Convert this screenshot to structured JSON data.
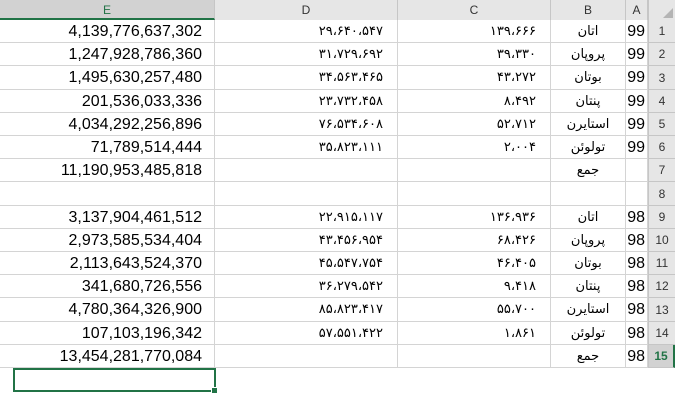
{
  "columns": [
    "E",
    "D",
    "C",
    "B",
    "A"
  ],
  "rows": [
    {
      "num": "1",
      "A": "99",
      "B": "اتان",
      "C": "۱۳۹،۶۶۶",
      "D": "۲۹،۶۴۰،۵۴۷",
      "E": "4,139,776,637,302"
    },
    {
      "num": "2",
      "A": "99",
      "B": "پروپان",
      "C": "۳۹،۳۳۰",
      "D": "۳۱،۷۲۹،۶۹۲",
      "E": "1,247,928,786,360"
    },
    {
      "num": "3",
      "A": "99",
      "B": "بوتان",
      "C": "۴۳،۲۷۲",
      "D": "۳۴،۵۶۳،۴۶۵",
      "E": "1,495,630,257,480"
    },
    {
      "num": "4",
      "A": "99",
      "B": "پنتان",
      "C": "۸،۴۹۲",
      "D": "۲۳،۷۳۲،۴۵۸",
      "E": "201,536,033,336"
    },
    {
      "num": "5",
      "A": "99",
      "B": "استایرن",
      "C": "۵۲،۷۱۲",
      "D": "۷۶،۵۳۴،۶۰۸",
      "E": "4,034,292,256,896"
    },
    {
      "num": "6",
      "A": "99",
      "B": "تولوئن",
      "C": "۲،۰۰۴",
      "D": "۳۵،۸۲۳،۱۱۱",
      "E": "71,789,514,444"
    },
    {
      "num": "7",
      "A": "",
      "B": "جمع",
      "C": "",
      "D": "",
      "E": "11,190,953,485,818"
    },
    {
      "num": "8",
      "A": "",
      "B": "",
      "C": "",
      "D": "",
      "E": ""
    },
    {
      "num": "9",
      "A": "98",
      "B": "اتان",
      "C": "۱۳۶،۹۳۶",
      "D": "۲۲،۹۱۵،۱۱۷",
      "E": "3,137,904,461,512"
    },
    {
      "num": "10",
      "A": "98",
      "B": "پروپان",
      "C": "۶۸،۴۲۶",
      "D": "۴۳،۴۵۶،۹۵۴",
      "E": "2,973,585,534,404"
    },
    {
      "num": "11",
      "A": "98",
      "B": "بوتان",
      "C": "۴۶،۴۰۵",
      "D": "۴۵،۵۴۷،۷۵۴",
      "E": "2,113,643,524,370"
    },
    {
      "num": "12",
      "A": "98",
      "B": "پنتان",
      "C": "۹،۴۱۸",
      "D": "۳۶،۲۷۹،۵۴۲",
      "E": "341,680,726,556"
    },
    {
      "num": "13",
      "A": "98",
      "B": "استایرن",
      "C": "۵۵،۷۰۰",
      "D": "۸۵،۸۲۳،۴۱۷",
      "E": "4,780,364,326,900"
    },
    {
      "num": "14",
      "A": "98",
      "B": "تولوئن",
      "C": "۱،۸۶۱",
      "D": "۵۷،۵۵۱،۴۲۲",
      "E": "107,103,196,342"
    },
    {
      "num": "15",
      "A": "98",
      "B": "جمع",
      "C": "",
      "D": "",
      "E": "13,454,281,770,084"
    }
  ],
  "selection": {
    "row": "15",
    "column": "E"
  },
  "colors": {
    "accent": "#217346",
    "header_bg": "#e6e6e6",
    "gridline": "#d4d4d4"
  }
}
